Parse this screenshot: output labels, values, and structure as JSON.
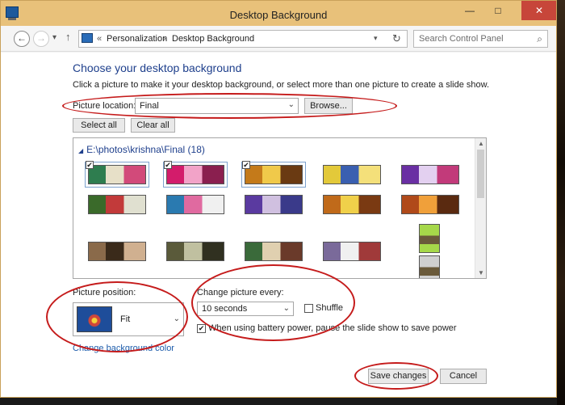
{
  "window": {
    "title": "Desktop Background",
    "minimize_glyph": "—",
    "maximize_glyph": "□",
    "close_glyph": "✕"
  },
  "nav": {
    "back_glyph": "←",
    "forward_glyph": "→",
    "recent_glyph": "▾",
    "up_glyph": "↑",
    "breadcrumb_separator": "«",
    "breadcrumb_arrow": "›",
    "breadcrumbs": [
      "Personalization",
      "Desktop Background"
    ],
    "refresh_glyph": "↻",
    "dropdown_glyph": "▾",
    "search_placeholder": "Search Control Panel",
    "search_glyph": "⌕"
  },
  "content": {
    "heading": "Choose your desktop background",
    "description": "Click a picture to make it your desktop background, or select more than one picture to create a slide show.",
    "picture_location_label": "Picture location:",
    "picture_location_value": "Final",
    "browse_label": "Browse...",
    "select_all_label": "Select all",
    "clear_all_label": "Clear all",
    "folder_label": "E:\\photos\\krishna\\Final (18)",
    "check_glyph": "✔",
    "picture_position_label": "Picture position:",
    "picture_position_value": "Fit",
    "change_every_label": "Change picture every:",
    "change_every_value": "10 seconds",
    "shuffle_label": "Shuffle",
    "shuffle_checked": false,
    "battery_label": "When using battery power, pause the slide show to save power",
    "battery_checked": true,
    "change_color_link": "Change background color",
    "save_label": "Save changes",
    "cancel_label": "Cancel"
  },
  "thumbnails": [
    {
      "selected": true,
      "colors": [
        "#2e7d4f",
        "#e7e0c8",
        "#d24a7a"
      ]
    },
    {
      "selected": true,
      "colors": [
        "#d31c6b",
        "#f2a3c8",
        "#8a1f4f"
      ]
    },
    {
      "selected": true,
      "colors": [
        "#c47a1a",
        "#f0c94a",
        "#6a3a12"
      ]
    },
    {
      "selected": false,
      "colors": [
        "#e3c93a",
        "#3a5fb0",
        "#f4e07a"
      ]
    },
    {
      "selected": false,
      "colors": [
        "#6a2fa3",
        "#e3d0f0",
        "#c23a7a"
      ]
    },
    {
      "selected": false,
      "colors": [
        "#3a6a2a",
        "#c23a3a",
        "#e0e0d0"
      ]
    },
    {
      "selected": false,
      "colors": [
        "#2a7ab0",
        "#e06aa0",
        "#f0f0f0"
      ]
    },
    {
      "selected": false,
      "colors": [
        "#5a3aa0",
        "#d0c0e0",
        "#3a3a8a"
      ]
    },
    {
      "selected": false,
      "colors": [
        "#c06a1a",
        "#f0d04a",
        "#7a3a12"
      ]
    },
    {
      "selected": false,
      "colors": [
        "#b04a1a",
        "#f0a03a",
        "#5a2a10"
      ]
    },
    {
      "selected": false,
      "colors": [
        "#8a6a4a",
        "#3a2a1a",
        "#d0b090"
      ]
    },
    {
      "selected": false,
      "colors": [
        "#5a5a3a",
        "#c0c0a0",
        "#303020"
      ]
    },
    {
      "selected": false,
      "colors": [
        "#3a6a3a",
        "#e0d0b0",
        "#6a3a2a"
      ]
    },
    {
      "selected": false,
      "colors": [
        "#7a6a9a",
        "#f0f0f0",
        "#a03a3a"
      ]
    }
  ],
  "colors": {
    "titlebar": "#e8c17a",
    "heading": "#1e3f8c",
    "link": "#1e5cab",
    "annotation": "#c51b1b"
  }
}
